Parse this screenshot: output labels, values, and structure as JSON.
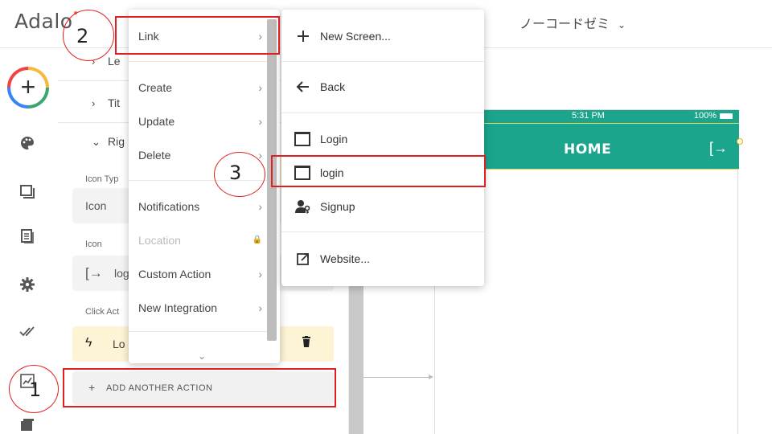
{
  "topbar": {
    "logo": "Adalo",
    "project_name": "ノーコードゼミ",
    "project_chevron": "⌄"
  },
  "rail": {
    "add_icon": "plus-icon",
    "icons": [
      "palette-icon",
      "screens-icon",
      "database-icon",
      "gear-icon",
      "double-check-icon",
      "analytics-icon",
      "layers-icon"
    ]
  },
  "panel": {
    "rows": [
      {
        "arrow": "›",
        "label": "Le"
      },
      {
        "arrow": "›",
        "label": "Tit"
      },
      {
        "arrow": "⌄",
        "label": "Rig"
      }
    ],
    "icon_type_label": "Icon Typ",
    "icon_type_value": "Icon",
    "icon_label": "Icon",
    "icon_value": "log",
    "click_action_label": "Click Act",
    "action_value": "Lo",
    "add_action_label": "ADD ANOTHER ACTION"
  },
  "menu1": {
    "items": [
      {
        "label": "Link",
        "chevron": "›",
        "disabled": false
      },
      {
        "label": "Create",
        "chevron": "›",
        "disabled": false
      },
      {
        "label": "Update",
        "chevron": "›",
        "disabled": false
      },
      {
        "label": "Delete",
        "chevron": "›",
        "disabled": false
      },
      {
        "label": "Notifications",
        "chevron": "›",
        "disabled": false
      },
      {
        "label": "Location",
        "chevron": "🔒",
        "disabled": true
      },
      {
        "label": "Custom Action",
        "chevron": "›",
        "disabled": false
      },
      {
        "label": "New Integration",
        "chevron": "›",
        "disabled": false
      }
    ],
    "more": "⌄"
  },
  "menu2": {
    "items": [
      {
        "label": "New Screen...",
        "icon": "plus-icon"
      },
      {
        "label": "Back",
        "icon": "arrow-left-icon"
      },
      {
        "label": "Login",
        "icon": "screen-icon"
      },
      {
        "label": "login",
        "icon": "screen-icon"
      },
      {
        "label": "Signup",
        "icon": "user-key-icon"
      },
      {
        "label": "Website...",
        "icon": "external-link-icon"
      }
    ]
  },
  "phone": {
    "time": "5:31 PM",
    "battery": "100%",
    "title": "HOME"
  },
  "annotations": [
    "1",
    "2",
    "3"
  ],
  "colors": {
    "teal": "#1ba58d",
    "highlight": "#fdf1cf",
    "annotation_red": "#e02020"
  }
}
